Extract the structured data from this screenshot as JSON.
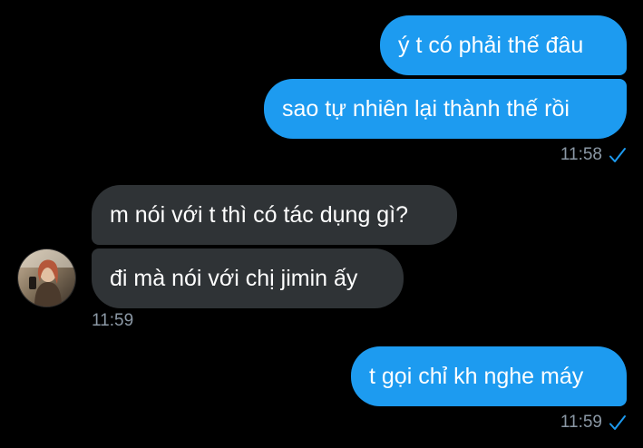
{
  "colors": {
    "background": "#000000",
    "outgoing_bubble": "#1d9bf0",
    "incoming_bubble": "#2f3336",
    "meta_text": "#8b98a5",
    "read_check": "#1d9bf0"
  },
  "messages": {
    "out1": "ý t có phải thế đâu",
    "out2": "sao tự nhiên lại thành thế rồi",
    "in1": "m nói với t thì có tác dụng gì?",
    "in2": "đi mà nói với chị jimin ấy",
    "out3": "t gọi chỉ kh nghe máy"
  },
  "timestamps": {
    "group1": "11:58",
    "group2": "11:59",
    "group3": "11:59"
  },
  "icons": {
    "read_receipt": "check-icon",
    "contact_avatar": "avatar"
  }
}
